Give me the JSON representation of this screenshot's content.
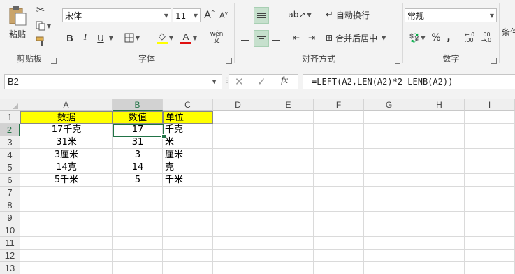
{
  "ribbon": {
    "clipboard": {
      "paste": "粘贴",
      "label": "剪贴板"
    },
    "font": {
      "name": "宋体",
      "size": "11",
      "bold": "B",
      "italic": "I",
      "underline": "U",
      "wen": "wén",
      "label": "字体"
    },
    "alignment": {
      "wrap": "自动换行",
      "merge": "合并后居中",
      "label": "对齐方式"
    },
    "number": {
      "format": "常规",
      "percent": "%",
      "comma": ",",
      "label": "数字"
    },
    "styles": {
      "cond": "条件"
    }
  },
  "formula_bar": {
    "name_box": "B2",
    "cancel": "✕",
    "enter": "✓",
    "fx": "fx",
    "formula": "=LEFT(A2,LEN(A2)*2-LENB(A2))"
  },
  "grid": {
    "columns": [
      "A",
      "B",
      "C",
      "D",
      "E",
      "F",
      "G",
      "H",
      "I"
    ],
    "rows": [
      "1",
      "2",
      "3",
      "4",
      "5",
      "6",
      "7",
      "8",
      "9",
      "10",
      "11",
      "12",
      "13"
    ],
    "active_cell": "B2",
    "data": [
      [
        "数据",
        "数值",
        "单位"
      ],
      [
        "17千克",
        "17",
        "千克"
      ],
      [
        "31米",
        "31",
        "米"
      ],
      [
        "3厘米",
        "3",
        "厘米"
      ],
      [
        "14克",
        "14",
        "克"
      ],
      [
        "5千米",
        "5",
        "千米"
      ]
    ],
    "header_fill": "#ffff00",
    "accent": "#217346"
  }
}
